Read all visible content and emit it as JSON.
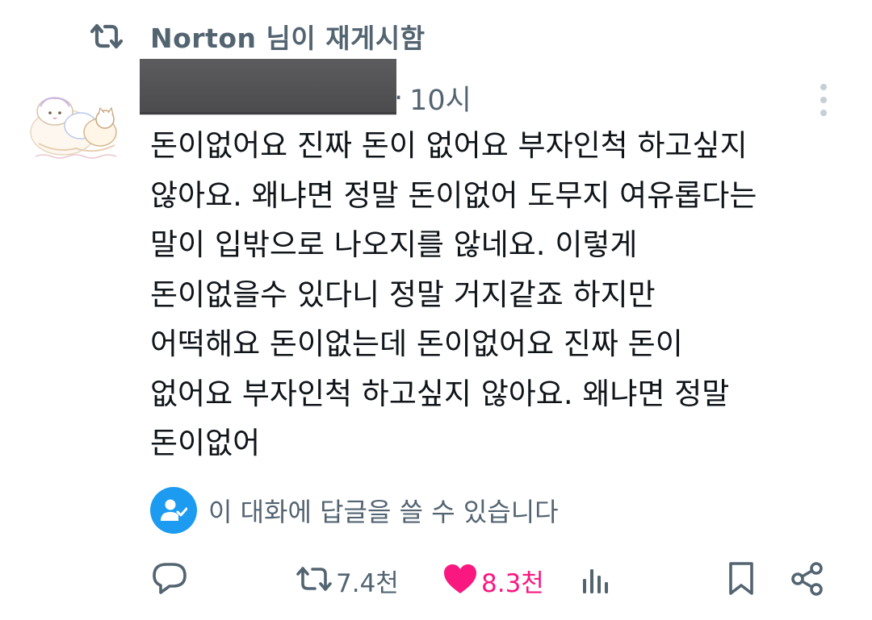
{
  "repost_header": {
    "icon": "repost-icon",
    "text": "Norton 님이 재게시함"
  },
  "post": {
    "time": "10시",
    "separator": "·",
    "lines": [
      "돈이없어요 진짜 돈이 없어요 부자인척 하고싶지",
      "않아요. 왜냐면 정말 돈이없어 도무지 여유롭다는",
      "말이 입밖으로 나오지를 않네요. 이렇게",
      "돈이없을수 있다니 정말 거지같죠 하지만",
      "어떡해요 돈이없는데 돈이없어요 진짜 돈이",
      "없어요 부자인척 하고싶지 않아요. 왜냐면 정말",
      "돈이없어"
    ]
  },
  "reply_restriction": {
    "icon": "person-check-icon",
    "text": "이 대화에 답글을 쓸 수 있습니다"
  },
  "actions": {
    "reply_icon": "reply-icon",
    "repost_icon": "repost-icon",
    "repost_count": "7.4천",
    "like_icon": "heart-icon",
    "like_count": "8.3천",
    "views_icon": "views-icon",
    "bookmark_icon": "bookmark-icon",
    "share_icon": "share-icon"
  },
  "colors": {
    "text_primary": "#0f1419",
    "text_secondary": "#536471",
    "like_pink": "#f91880",
    "accent_blue": "#1d9bf0"
  }
}
